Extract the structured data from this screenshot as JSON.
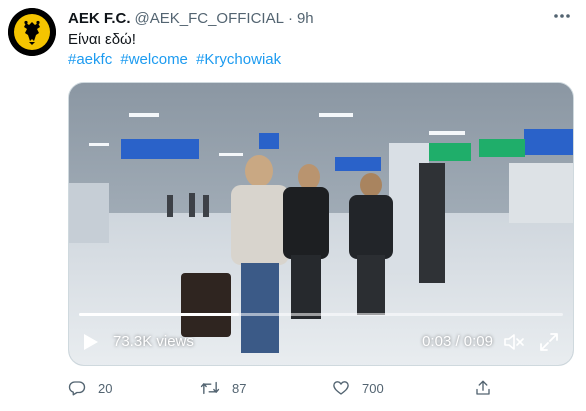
{
  "author": {
    "display_name": "AEK F.C.",
    "handle": "@AEK_FC_OFFICIAL",
    "separator": "·",
    "time": "9h",
    "avatar_icon": "aek-eagle-logo"
  },
  "tweet": {
    "text": "Είναι εδώ!",
    "hashtags": [
      "#aekfc",
      "#welcome",
      "#Krychowiak"
    ]
  },
  "video": {
    "views": "73.3K views",
    "timecode": "0:03 / 0:09",
    "progress": 0.33,
    "icons": {
      "play": "play-icon",
      "volume": "volume-muted-icon",
      "fullscreen": "fullscreen-icon"
    }
  },
  "actions": {
    "replies": "20",
    "retweets": "87",
    "likes": "700",
    "icons": [
      "reply-icon",
      "retweet-icon",
      "like-icon",
      "share-icon"
    ]
  },
  "colors": {
    "link": "#1d9bf0",
    "muted": "#536471",
    "text": "#0f1419",
    "avatar_yellow": "#f5c400"
  }
}
